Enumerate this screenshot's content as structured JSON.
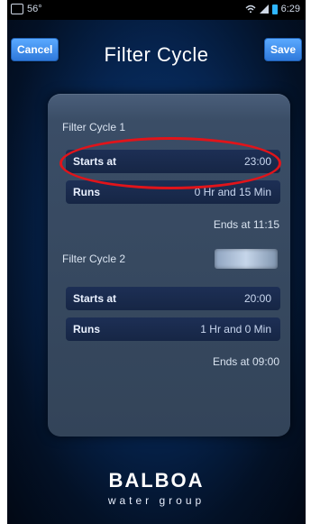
{
  "statusbar": {
    "left_temp": "56°",
    "time": "6:29"
  },
  "header": {
    "cancel_label": "Cancel",
    "title": "Filter Cycle",
    "save_label": "Save"
  },
  "filter_cycle_1": {
    "title": "Filter Cycle 1",
    "starts_at_label": "Starts at",
    "starts_at_value": "23:00",
    "runs_label": "Runs",
    "runs_value": "0 Hr and 15 Min",
    "ends_text": "Ends at 11:15"
  },
  "filter_cycle_2": {
    "title": "Filter Cycle 2",
    "starts_at_label": "Starts at",
    "starts_at_value": "20:00",
    "runs_label": "Runs",
    "runs_value": "1 Hr and 0 Min",
    "ends_text": "Ends at 09:00"
  },
  "brand": {
    "line1": "BALBOA",
    "line2": "water group"
  }
}
